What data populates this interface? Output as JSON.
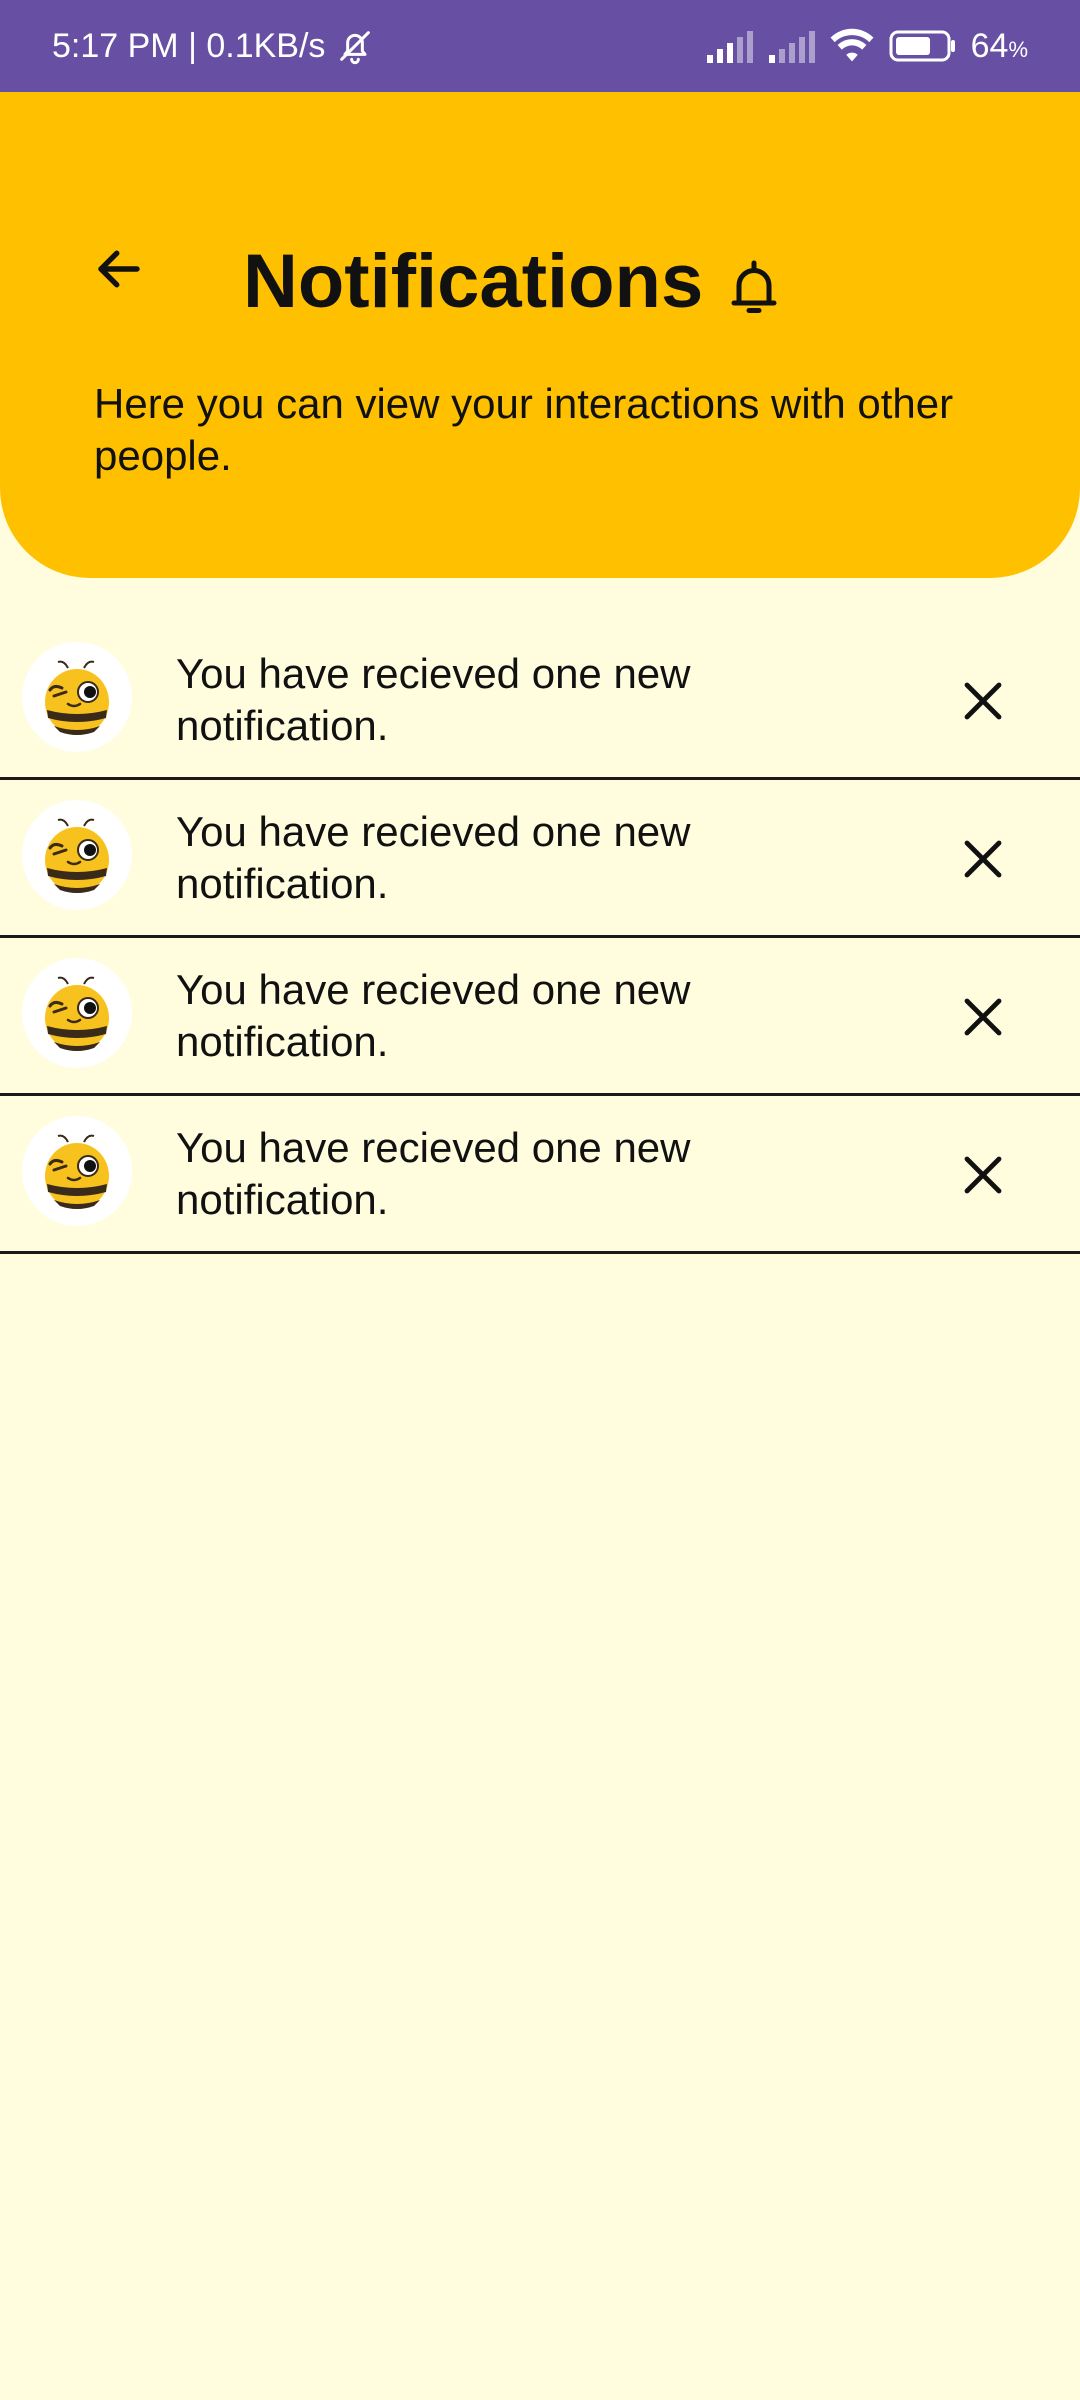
{
  "status_bar": {
    "time_speed": "5:17 PM | 0.1KB/s",
    "battery": "64",
    "battery_unit": "%"
  },
  "header": {
    "title": "Notifications",
    "description": "Here you can view your interactions with other people."
  },
  "notifications": [
    {
      "text": "You have recieved one new notification.",
      "avatar_icon": "bee-wink-icon"
    },
    {
      "text": "You have recieved one new notification.",
      "avatar_icon": "bee-wink-icon"
    },
    {
      "text": "You have recieved one new notification.",
      "avatar_icon": "bee-wink-icon"
    },
    {
      "text": "You have recieved one new notification.",
      "avatar_icon": "bee-wink-icon"
    }
  ],
  "colors": {
    "status_bar": "#6750A4",
    "header": "#FFC000",
    "background": "#FFFDDE"
  },
  "icons": {
    "back": "arrow-left-icon",
    "title": "bell-icon",
    "dismiss": "close-icon"
  }
}
